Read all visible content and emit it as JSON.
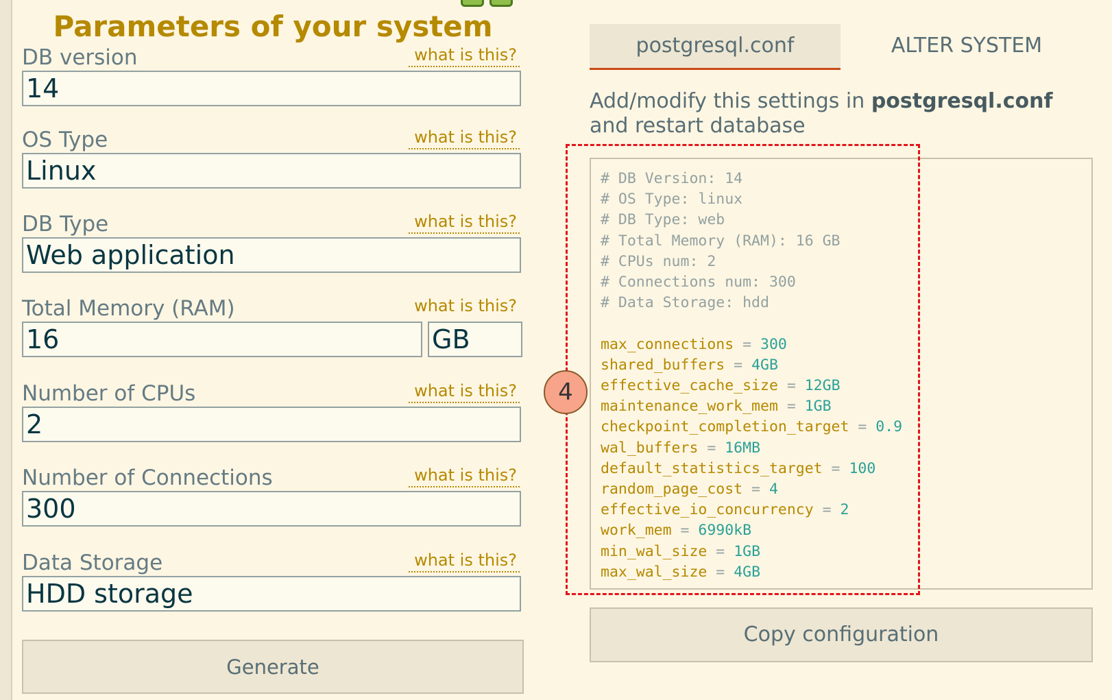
{
  "form": {
    "title": "Parameters of your system",
    "help_label": "what is this?",
    "db_version": {
      "label": "DB version",
      "value": "14"
    },
    "os_type": {
      "label": "OS Type",
      "value": "Linux"
    },
    "db_type": {
      "label": "DB Type",
      "value": "Web application"
    },
    "memory": {
      "label": "Total Memory (RAM)",
      "value": "16",
      "unit": "GB"
    },
    "cpus": {
      "label": "Number of CPUs",
      "value": "2"
    },
    "connections": {
      "label": "Number of Connections",
      "value": "300"
    },
    "storage": {
      "label": "Data Storage",
      "value": "HDD storage"
    },
    "generate_label": "Generate"
  },
  "tabs": {
    "active": "postgresql.conf",
    "inactive": "ALTER SYSTEM"
  },
  "info": {
    "prefix": "Add/modify this settings in ",
    "file": "postgresql.conf",
    "suffix": " and restart database"
  },
  "config": {
    "comments": [
      "# DB Version: 14",
      "# OS Type: linux",
      "# DB Type: web",
      "# Total Memory (RAM): 16 GB",
      "# CPUs num: 2",
      "# Connections num: 300",
      "# Data Storage: hdd"
    ],
    "settings": [
      {
        "key": "max_connections",
        "value": "300"
      },
      {
        "key": "shared_buffers",
        "value": "4GB"
      },
      {
        "key": "effective_cache_size",
        "value": "12GB"
      },
      {
        "key": "maintenance_work_mem",
        "value": "1GB"
      },
      {
        "key": "checkpoint_completion_target",
        "value": "0.9"
      },
      {
        "key": "wal_buffers",
        "value": "16MB"
      },
      {
        "key": "default_statistics_target",
        "value": "100"
      },
      {
        "key": "random_page_cost",
        "value": "4"
      },
      {
        "key": "effective_io_concurrency",
        "value": "2"
      },
      {
        "key": "work_mem",
        "value": "6990kB"
      },
      {
        "key": "min_wal_size",
        "value": "1GB"
      },
      {
        "key": "max_wal_size",
        "value": "4GB"
      }
    ],
    "eq": " = "
  },
  "annotation": {
    "number": "4",
    "highlight_color": "#e0161c"
  },
  "copy_label": "Copy configuration"
}
